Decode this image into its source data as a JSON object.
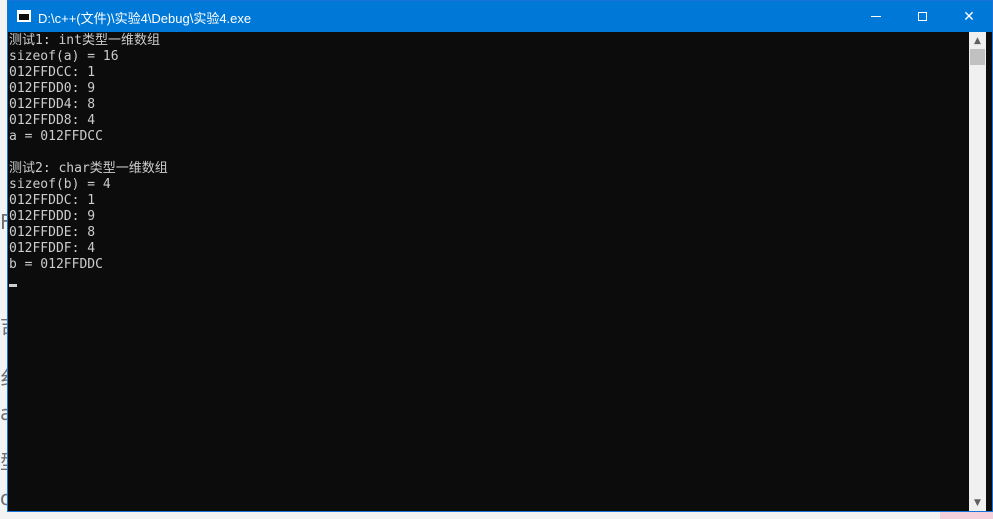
{
  "window": {
    "title": "D:\\c++(文件)\\实验4\\Debug\\实验4.exe"
  },
  "controls": {
    "minimize_icon": "minimize-icon",
    "maximize_icon": "maximize-icon",
    "close_glyph": "✕"
  },
  "console": {
    "lines": [
      "测试1: int类型一维数组",
      "sizeof(a) = 16",
      "012FFDCC: 1",
      "012FFDD0: 9",
      "012FFDD4: 8",
      "012FFDD8: 4",
      "a = 012FFDCC",
      "",
      "测试2: char类型一维数组",
      "sizeof(b) = 4",
      "012FFDDC: 1",
      "012FFDDD: 9",
      "012FFDDE: 8",
      "012FFDDF: 4",
      "b = 012FFDDC"
    ]
  },
  "scrollbar": {
    "up_glyph": "▲",
    "down_glyph": "▼"
  },
  "background_fragments": [
    "F",
    "吉",
    "纟",
    "a",
    "型",
    "o"
  ],
  "colors": {
    "titlebar": "#0078d7",
    "console_bg": "#0c0c0c",
    "console_text": "#cccccc"
  }
}
